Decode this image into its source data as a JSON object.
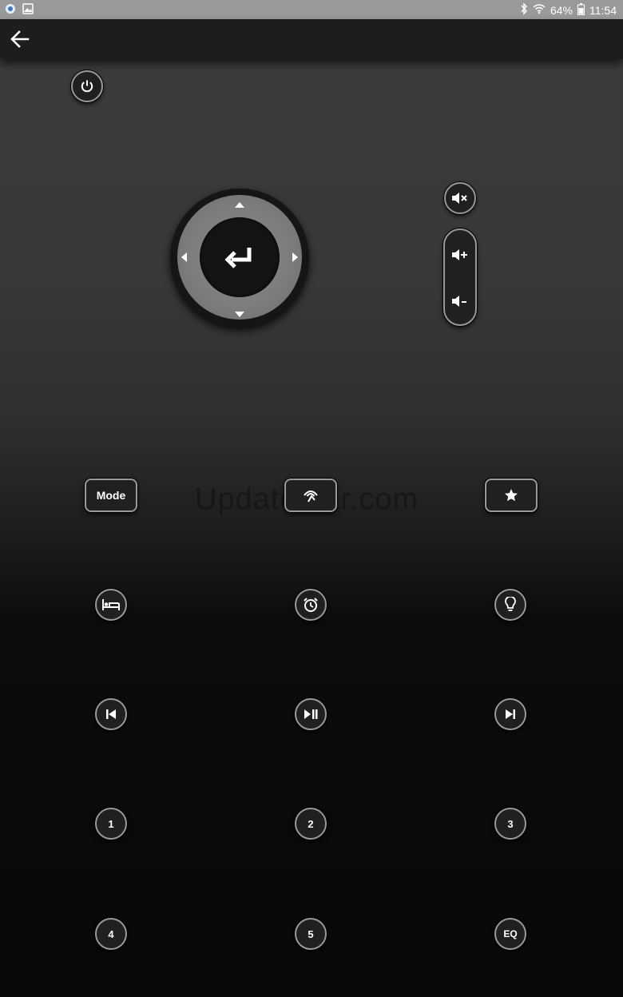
{
  "status_bar": {
    "battery": "64%",
    "time": "11:54",
    "icons": [
      "notification-dot-icon",
      "gallery-icon",
      "bluetooth-icon",
      "wifi-icon",
      "battery-icon"
    ]
  },
  "toolbar": {
    "back_icon": "arrow-left-icon"
  },
  "remote": {
    "power_icon": "power-icon",
    "dpad": {
      "up_icon": "triangle-up-icon",
      "down_icon": "triangle-down-icon",
      "left_icon": "triangle-left-icon",
      "right_icon": "triangle-right-icon",
      "center_icon": "enter-return-icon"
    },
    "volume": {
      "mute_icon": "volume-mute-icon",
      "up_icon": "volume-up-icon",
      "down_icon": "volume-down-icon"
    },
    "row1": {
      "mode_label": "Mode",
      "middle_icon": "radio-signal-icon",
      "right_icon": "star-icon"
    },
    "row2": {
      "left_icon": "bed-sleep-icon",
      "middle_icon": "alarm-clock-icon",
      "right_icon": "lightbulb-icon"
    },
    "row3": {
      "left_icon": "skip-previous-icon",
      "middle_icon": "play-pause-icon",
      "right_icon": "skip-next-icon"
    },
    "row4": {
      "labels": [
        "1",
        "2",
        "3"
      ]
    },
    "row5": {
      "labels": [
        "4",
        "5",
        "EQ"
      ]
    }
  },
  "watermark": "Updatestar.com",
  "colors": {
    "button_border": "#9a9a9a",
    "button_fill": "#202020",
    "dpad_ring": "#7c7c7c"
  }
}
